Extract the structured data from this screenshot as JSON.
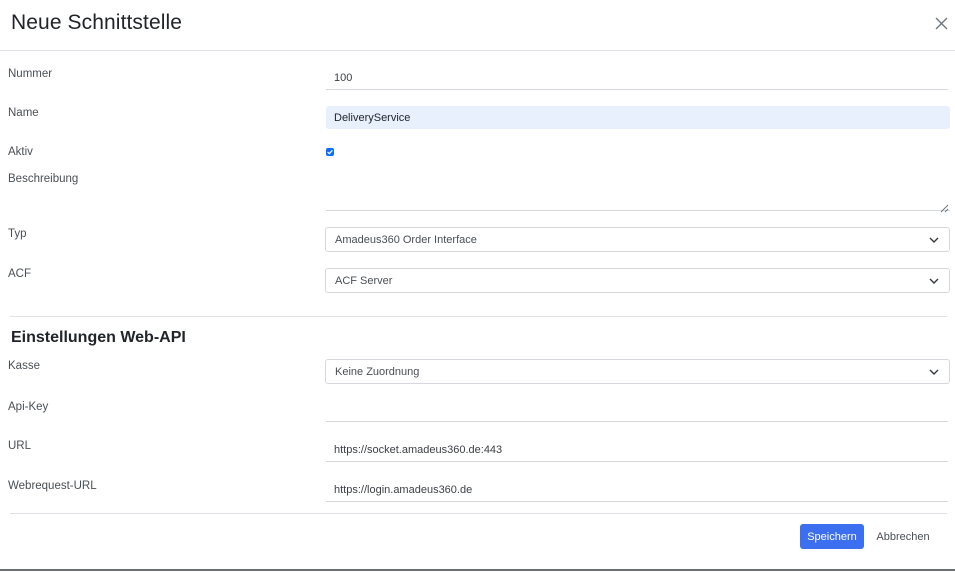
{
  "dialog": {
    "title": "Neue Schnittstelle",
    "close_icon": "close-icon"
  },
  "form": {
    "nummer": {
      "label": "Nummer",
      "value": "100"
    },
    "name": {
      "label": "Name",
      "value": "DeliveryService"
    },
    "aktiv": {
      "label": "Aktiv",
      "checked": true
    },
    "beschreibung": {
      "label": "Beschreibung",
      "value": ""
    },
    "typ": {
      "label": "Typ",
      "value": "Amadeus360 Order Interface"
    },
    "acf": {
      "label": "ACF",
      "value": "ACF Server"
    }
  },
  "web_api": {
    "title": "Einstellungen Web-API",
    "kasse": {
      "label": "Kasse",
      "value": "Keine Zuordnung"
    },
    "api_key": {
      "label": "Api-Key",
      "value": ""
    },
    "url": {
      "label": "URL",
      "value": "https://socket.amadeus360.de:443"
    },
    "webrequest_url": {
      "label": "Webrequest-URL",
      "value": "https://login.amadeus360.de"
    }
  },
  "footer": {
    "save_label": "Speichern",
    "cancel_label": "Abbrechen"
  },
  "colors": {
    "primary": "#3b6ff0",
    "autofill_bg": "#e8f0fe",
    "checkbox": "#0d6efd"
  }
}
